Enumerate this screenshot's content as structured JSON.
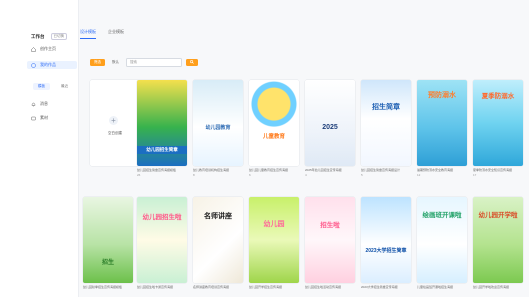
{
  "sidebar": {
    "workspace_title": "工作台",
    "workspace_tag": "已切换",
    "nav": [
      {
        "label": "创作主页",
        "icon": "home-icon"
      },
      {
        "label": "我的作品",
        "icon": "layers-icon"
      },
      {
        "label": "消息",
        "icon": "bell-icon"
      },
      {
        "label": "素材",
        "icon": "folder-icon"
      }
    ],
    "subtabs": [
      "模板",
      "最近"
    ]
  },
  "main": {
    "tabs": [
      "设计模板",
      "企业模板"
    ],
    "toolbar": {
      "filter_label": "筛选",
      "chip_label": "默认",
      "search_value": "搜索"
    },
    "new_card_label": "空白创建"
  },
  "cards_row1": [
    {
      "title": "幼儿园招生简章",
      "caption": "幼儿园招生简章宣传海报模板",
      "meta": "26"
    },
    {
      "title": "幼儿园教育",
      "caption": "幼儿教育培训机构招生海报",
      "meta": "8"
    },
    {
      "title": "儿童教育",
      "caption": "幼儿园儿童教育招生宣传海报",
      "meta": "6"
    },
    {
      "title": "2025",
      "caption": "2025年幼儿园招生宣传海报",
      "meta": "4"
    },
    {
      "title": "招生简章",
      "caption": "幼儿园招生简章宣传海报设计",
      "meta": "5"
    },
    {
      "title": "预防溺水",
      "caption": "暑期预防溺水安全教育海报",
      "meta": "12"
    },
    {
      "title": "夏季防溺水",
      "caption": "夏季防溺水安全知识宣传海报",
      "meta": "17"
    }
  ],
  "cards_row2": [
    {
      "title": "招生",
      "caption": "幼儿园秋季招生宣传海报模板"
    },
    {
      "title": "幼儿园招生啦",
      "caption": "幼儿园招生啦卡通宣传海报"
    },
    {
      "title": "名师讲座",
      "caption": "名师讲座教育培训宣传海报"
    },
    {
      "title": "幼儿园",
      "caption": "幼儿园开学招生宣传海报"
    },
    {
      "title": "招生啦",
      "caption": "幼儿园招生啦活动宣传海报"
    },
    {
      "title": "2023大学招生简章",
      "caption": "2023大学招生简章宣传海报"
    },
    {
      "title": "绘画班开课啦",
      "caption": "儿童绘画班开课啦招生海报"
    },
    {
      "title": "幼儿园开学啦",
      "caption": "幼儿园开学啦欢迎宣传海报"
    }
  ],
  "colors": {
    "accent": "#2f6df6",
    "orange": "#ff9f1c"
  }
}
